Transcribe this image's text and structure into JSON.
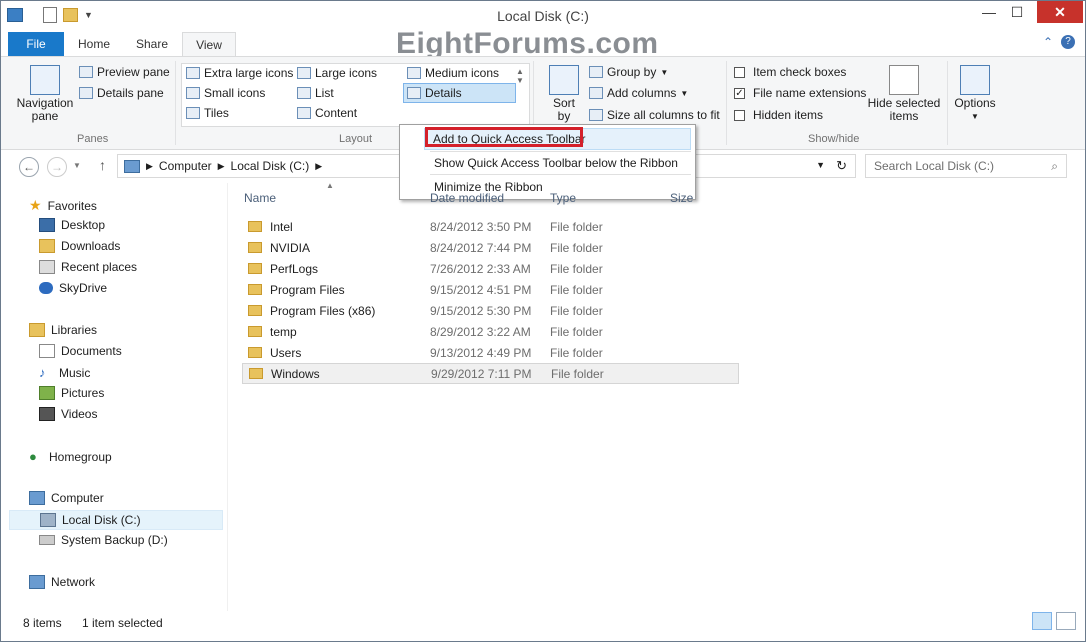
{
  "window": {
    "title": "Local Disk (C:)",
    "watermark": "EightForums.com"
  },
  "tabs": [
    {
      "label": "File"
    },
    {
      "label": "Home"
    },
    {
      "label": "Share"
    },
    {
      "label": "View"
    }
  ],
  "ribbon": {
    "panes": {
      "nav_label": "Navigation\npane",
      "preview": "Preview pane",
      "details": "Details pane",
      "group": "Panes"
    },
    "layout": {
      "items": [
        "Extra large icons",
        "Large icons",
        "Medium icons",
        "Small icons",
        "List",
        "Details",
        "Tiles",
        "Content"
      ],
      "group": "Layout"
    },
    "current_view": {
      "sort": "Sort\nby",
      "group_by": "Group by",
      "add_columns": "Add columns",
      "size_cols": "Size all columns to fit"
    },
    "show_hide": {
      "item_check": "Item check boxes",
      "file_ext": "File name extensions",
      "hidden": "Hidden items",
      "hide_selected": "Hide selected\nitems",
      "group": "Show/hide"
    },
    "options": "Options"
  },
  "context_menu": {
    "items": [
      "Add to Quick Access Toolbar",
      "Show Quick Access Toolbar below the Ribbon",
      "Minimize the Ribbon"
    ]
  },
  "address": {
    "crumbs": [
      "Computer",
      "Local Disk (C:)"
    ],
    "search_placeholder": "Search Local Disk (C:)"
  },
  "nav": {
    "favorites": "Favorites",
    "fav_items": [
      "Desktop",
      "Downloads",
      "Recent places",
      "SkyDrive"
    ],
    "libraries": "Libraries",
    "lib_items": [
      "Documents",
      "Music",
      "Pictures",
      "Videos"
    ],
    "homegroup": "Homegroup",
    "computer": "Computer",
    "comp_items": [
      "Local Disk (C:)",
      "System Backup (D:)"
    ],
    "network": "Network"
  },
  "columns": {
    "name": "Name",
    "date": "Date modified",
    "type": "Type",
    "size": "Size"
  },
  "files": [
    {
      "name": "Intel",
      "date": "8/24/2012 3:50 PM",
      "type": "File folder"
    },
    {
      "name": "NVIDIA",
      "date": "8/24/2012 7:44 PM",
      "type": "File folder"
    },
    {
      "name": "PerfLogs",
      "date": "7/26/2012 2:33 AM",
      "type": "File folder"
    },
    {
      "name": "Program Files",
      "date": "9/15/2012 4:51 PM",
      "type": "File folder"
    },
    {
      "name": "Program Files (x86)",
      "date": "9/15/2012 5:30 PM",
      "type": "File folder"
    },
    {
      "name": "temp",
      "date": "8/29/2012 3:22 AM",
      "type": "File folder"
    },
    {
      "name": "Users",
      "date": "9/13/2012 4:49 PM",
      "type": "File folder"
    },
    {
      "name": "Windows",
      "date": "9/29/2012 7:11 PM",
      "type": "File folder"
    }
  ],
  "status": {
    "count": "8 items",
    "selected": "1 item selected"
  },
  "colors": {
    "accent": "#1979ca",
    "highlight_box": "#d4202a"
  }
}
